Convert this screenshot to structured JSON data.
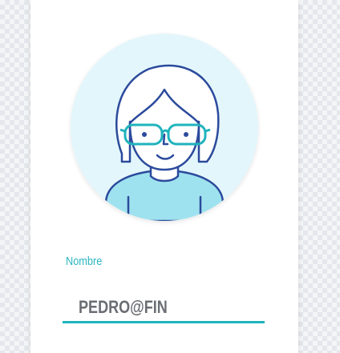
{
  "profile": {
    "avatar_icon": "user-avatar-icon",
    "name_label": "Nombre",
    "name_value": "PEDRO@FIN"
  },
  "colors": {
    "accent": "#1fb3bd",
    "label": "#2bb5c0",
    "avatar_bg": "#e3f6fb",
    "value_text": "#6a6e74"
  }
}
